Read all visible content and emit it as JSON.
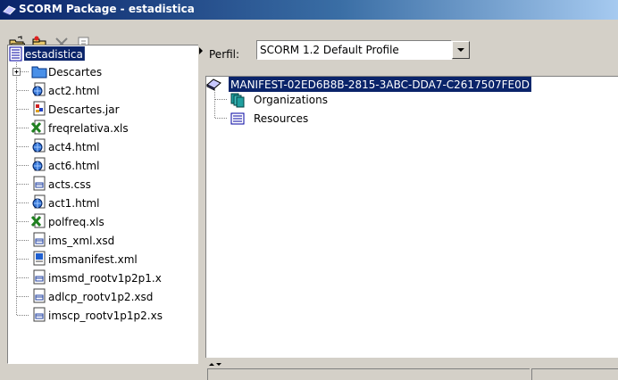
{
  "window": {
    "title": "SCORM Package - estadistica"
  },
  "toolbar": {
    "buttons": [
      {
        "name": "open-folder",
        "icon": "open-folder-icon"
      },
      {
        "name": "new-item",
        "icon": "new-item-icon"
      },
      {
        "name": "delete",
        "icon": "delete-icon"
      },
      {
        "name": "properties",
        "icon": "properties-icon"
      }
    ]
  },
  "perfil": {
    "label": "Perfil:",
    "selected": "SCORM 1.2 Default Profile"
  },
  "left_tree": {
    "root": {
      "label": "estadistica",
      "icon": "document-icon",
      "selected": true
    },
    "items": [
      {
        "label": "Descartes",
        "icon": "folder-icon",
        "expandable": true
      },
      {
        "label": "act2.html",
        "icon": "html-file-icon"
      },
      {
        "label": "Descartes.jar",
        "icon": "jar-file-icon"
      },
      {
        "label": "freqrelativa.xls",
        "icon": "excel-file-icon"
      },
      {
        "label": "act4.html",
        "icon": "html-file-icon"
      },
      {
        "label": "act6.html",
        "icon": "html-file-icon"
      },
      {
        "label": "acts.css",
        "icon": "css-file-icon"
      },
      {
        "label": "act1.html",
        "icon": "html-file-icon"
      },
      {
        "label": "polfreq.xls",
        "icon": "excel-file-icon"
      },
      {
        "label": "ims_xml.xsd",
        "icon": "xsd-file-icon"
      },
      {
        "label": "imsmanifest.xml",
        "icon": "xml-file-icon"
      },
      {
        "label": "imsmd_rootv1p2p1.x",
        "icon": "xsd-file-icon"
      },
      {
        "label": "adlcp_rootv1p2.xsd",
        "icon": "xsd-file-icon"
      },
      {
        "label": "imscp_rootv1p1p2.xs",
        "icon": "xsd-file-icon"
      }
    ]
  },
  "right_tree": {
    "root": {
      "label": "MANIFEST-02ED6B8B-2815-3ABC-DDA7-C2617507FE0D",
      "icon": "manifest-icon",
      "selected": true
    },
    "items": [
      {
        "label": "Organizations",
        "icon": "organizations-icon"
      },
      {
        "label": "Resources",
        "icon": "resources-icon"
      }
    ]
  },
  "colors": {
    "selection": "#0a246a",
    "titlebar_start": "#0a246a",
    "titlebar_end": "#a6caf0",
    "panel_bg": "#d4d0c8"
  }
}
